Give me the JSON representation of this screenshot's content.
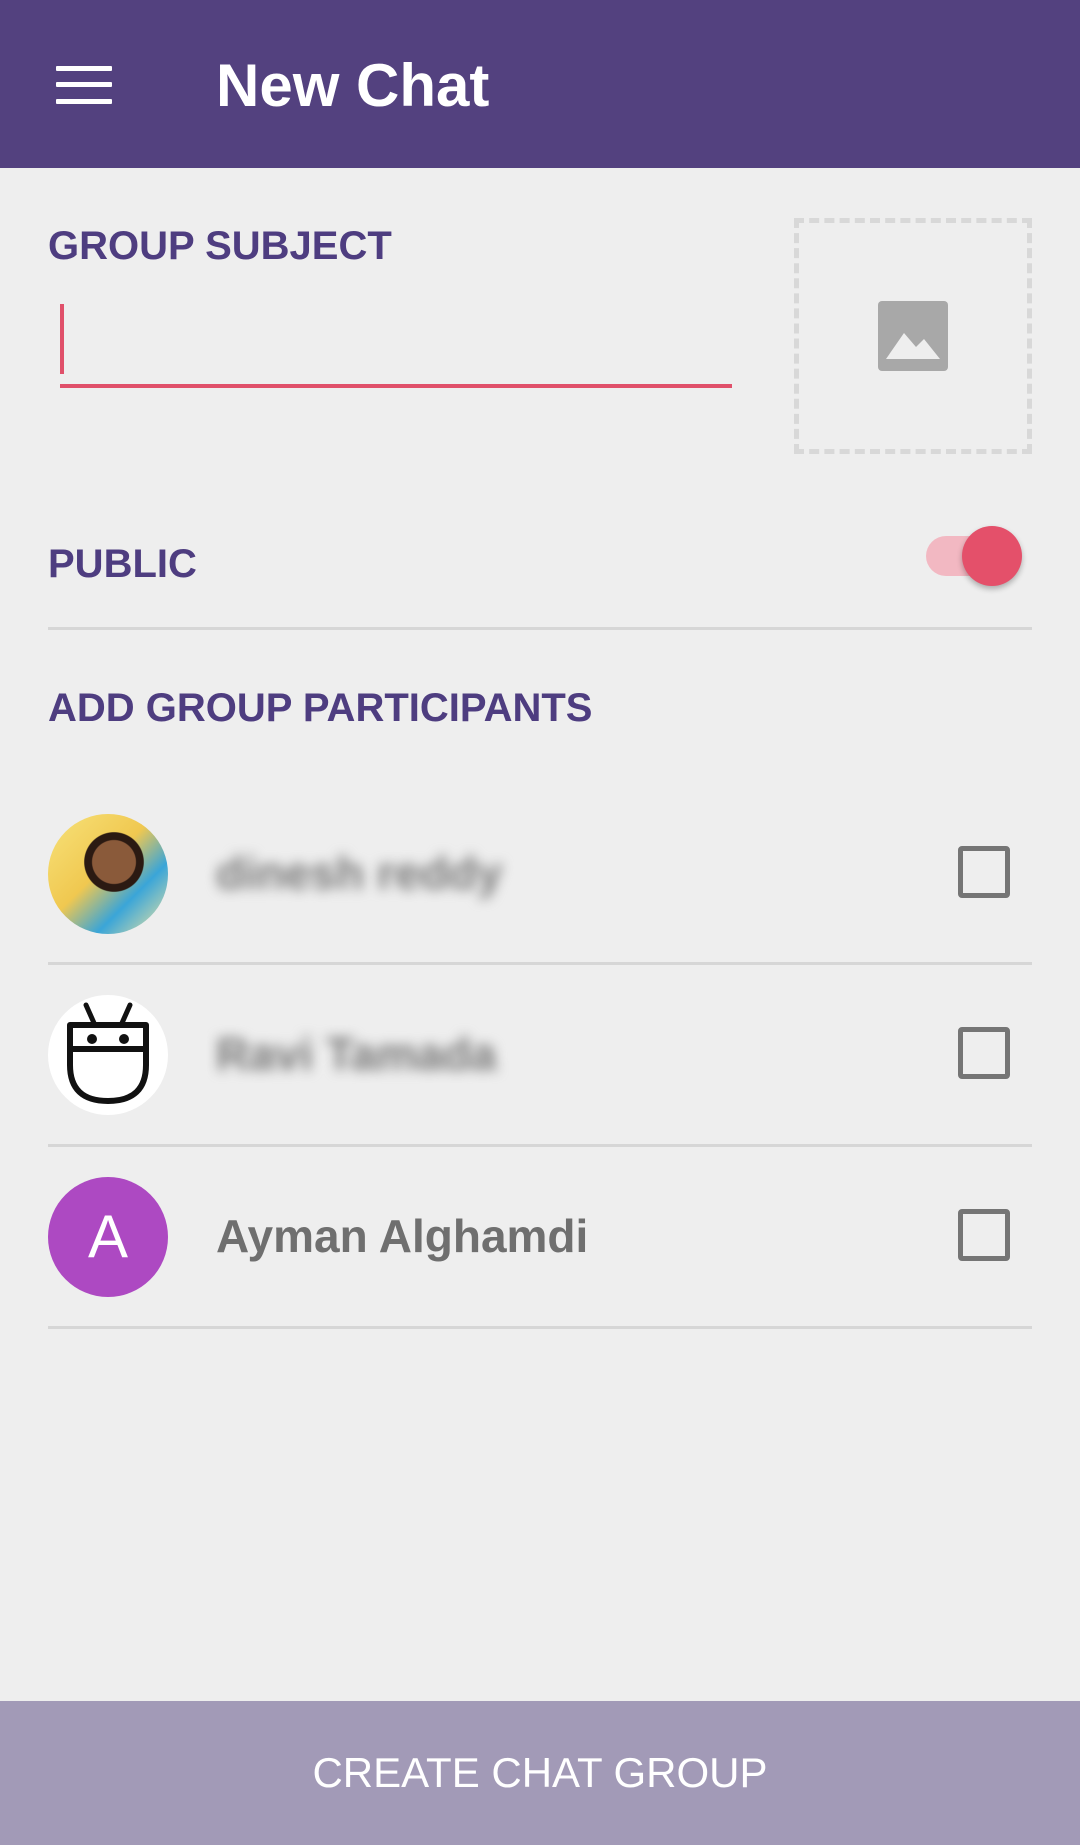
{
  "toolbar": {
    "title": "New Chat",
    "menu_icon": "menu-icon"
  },
  "group_subject": {
    "label": "GROUP SUBJECT",
    "value": "",
    "placeholder": ""
  },
  "image_picker": {
    "icon": "image-icon"
  },
  "public": {
    "label": "PUBLIC",
    "enabled": true
  },
  "participants": {
    "label": "ADD GROUP PARTICIPANTS",
    "items": [
      {
        "name": "dinesh reddy",
        "avatar": "photo",
        "checked": false
      },
      {
        "name": "Ravi Tamada",
        "avatar": "bot-face",
        "checked": false
      },
      {
        "name": "Ayman Alghamdi",
        "avatar_letter": "A",
        "checked": false
      }
    ]
  },
  "actions": {
    "create_label": "CREATE CHAT GROUP"
  },
  "colors": {
    "primary": "#53417f",
    "accent": "#e4506a",
    "letter_avatar": "#ad49c2",
    "button_disabled": "#a29ab7"
  }
}
